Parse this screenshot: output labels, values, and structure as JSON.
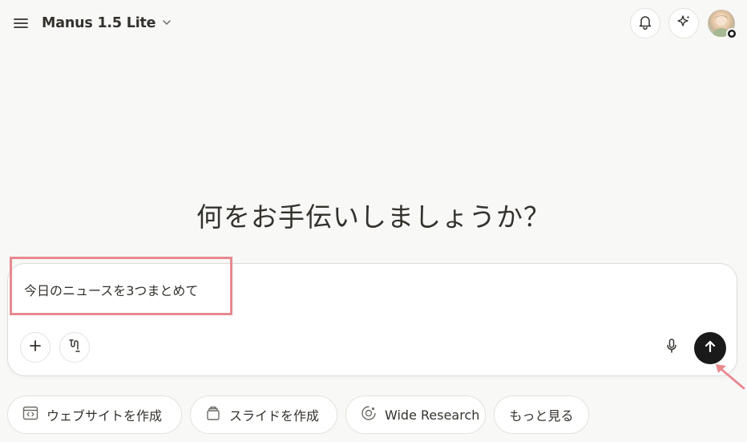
{
  "header": {
    "model_name": "Manus 1.5 Lite",
    "icons": [
      "menu-icon",
      "chevron-down-icon",
      "bell-icon",
      "sparkle-icon",
      "avatar"
    ]
  },
  "main": {
    "headline": "何をお手伝いしましょうか？"
  },
  "composer": {
    "input_value": "今日のニュースを3つまとめて",
    "icons": [
      "plus-icon",
      "connector-icon",
      "microphone-icon",
      "arrow-up-icon"
    ]
  },
  "quick_actions": [
    {
      "label": "ウェブサイトを作成",
      "icon": "website-icon"
    },
    {
      "label": "スライドを作成",
      "icon": "slides-icon"
    },
    {
      "label": "Wide Research",
      "icon": "wide-research-icon"
    },
    {
      "label": "もっと見る"
    }
  ],
  "colors": {
    "background": "#f8f8f7",
    "text": "#34322d",
    "send_button": "#1a1a1a",
    "annotation": "#e88990"
  }
}
